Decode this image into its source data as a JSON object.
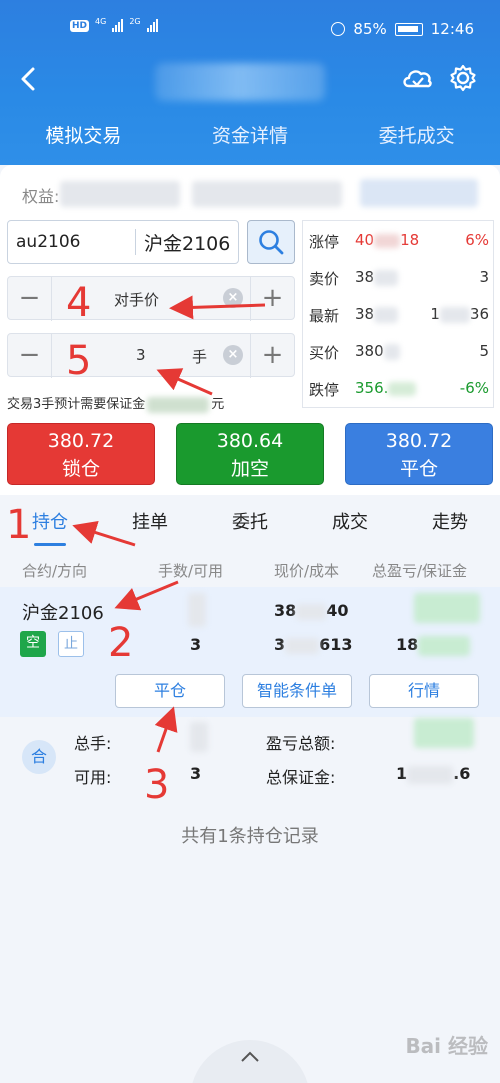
{
  "status_bar": {
    "sim_badge": "HD",
    "net1": "4G",
    "net2": "2G",
    "battery": "85%",
    "time": "12:46"
  },
  "icons": [
    "back-icon",
    "cloud-icon",
    "gear-icon",
    "search-icon",
    "clear-icon",
    "chevron-up-icon"
  ],
  "top_tabs": [
    "模拟交易",
    "资金详情",
    "委托成交"
  ],
  "equity_label": "权益:",
  "contract": {
    "code": "au2106",
    "name": "沪金2106"
  },
  "price_stepper": {
    "minus": "−",
    "value": "对手价",
    "clear": "×",
    "plus": "+"
  },
  "qty_stepper": {
    "minus": "−",
    "value": "3",
    "unit": "手",
    "clear": "×",
    "plus": "+"
  },
  "margin_note_prefix": "交易3手预计需要保证金",
  "margin_note_suffix": "元",
  "quote": {
    "rows": [
      {
        "label": "涨停",
        "v1": "40",
        "v1b": "18",
        "v2": "6%"
      },
      {
        "label": "卖价",
        "v1": "38",
        "v2": "3"
      },
      {
        "label": "最新",
        "v1": "38",
        "v2a": "1",
        "v2": "36"
      },
      {
        "label": "买价",
        "v1": "380",
        "v2": "5"
      },
      {
        "label": "跌停",
        "v1": "356.",
        "v2": "-6%"
      }
    ]
  },
  "actions": [
    {
      "price": "380.72",
      "label": "锁仓",
      "color": "#e53935"
    },
    {
      "price": "380.64",
      "label": "加空",
      "color": "#1a9a2e"
    },
    {
      "price": "380.72",
      "label": "平仓",
      "color": "#3a7fe0"
    }
  ],
  "sub_tabs": [
    "持仓",
    "挂单",
    "委托",
    "成交",
    "走势"
  ],
  "columns": [
    "合约/方向",
    "手数/可用",
    "现价/成本",
    "总盈亏/保证金"
  ],
  "position": {
    "name": "沪金2106",
    "direction_tag": "空",
    "stop_tag": "止",
    "qty_avail": "3",
    "price_now_a": "38",
    "price_now_b": "40",
    "cost_a": "3",
    "cost_b": "613",
    "margin_a": "18",
    "buttons": [
      "平仓",
      "智能条件单",
      "行情"
    ]
  },
  "summary": {
    "badge": "合",
    "total_qty_label": "总手:",
    "available_label": "可用:",
    "available_value": "3",
    "pnl_label": "盈亏总额:",
    "margin_label": "总保证金:",
    "margin_a": "1",
    "margin_b": ".6"
  },
  "record_note": "共有1条持仓记录",
  "watermark": "Bai 经验",
  "annotations": [
    "1",
    "2",
    "3",
    "4",
    "5"
  ],
  "colors": {
    "accent": "#2d7fe0",
    "up": "#e53935",
    "down": "#1a9a2e",
    "annotation": "#e53935"
  }
}
